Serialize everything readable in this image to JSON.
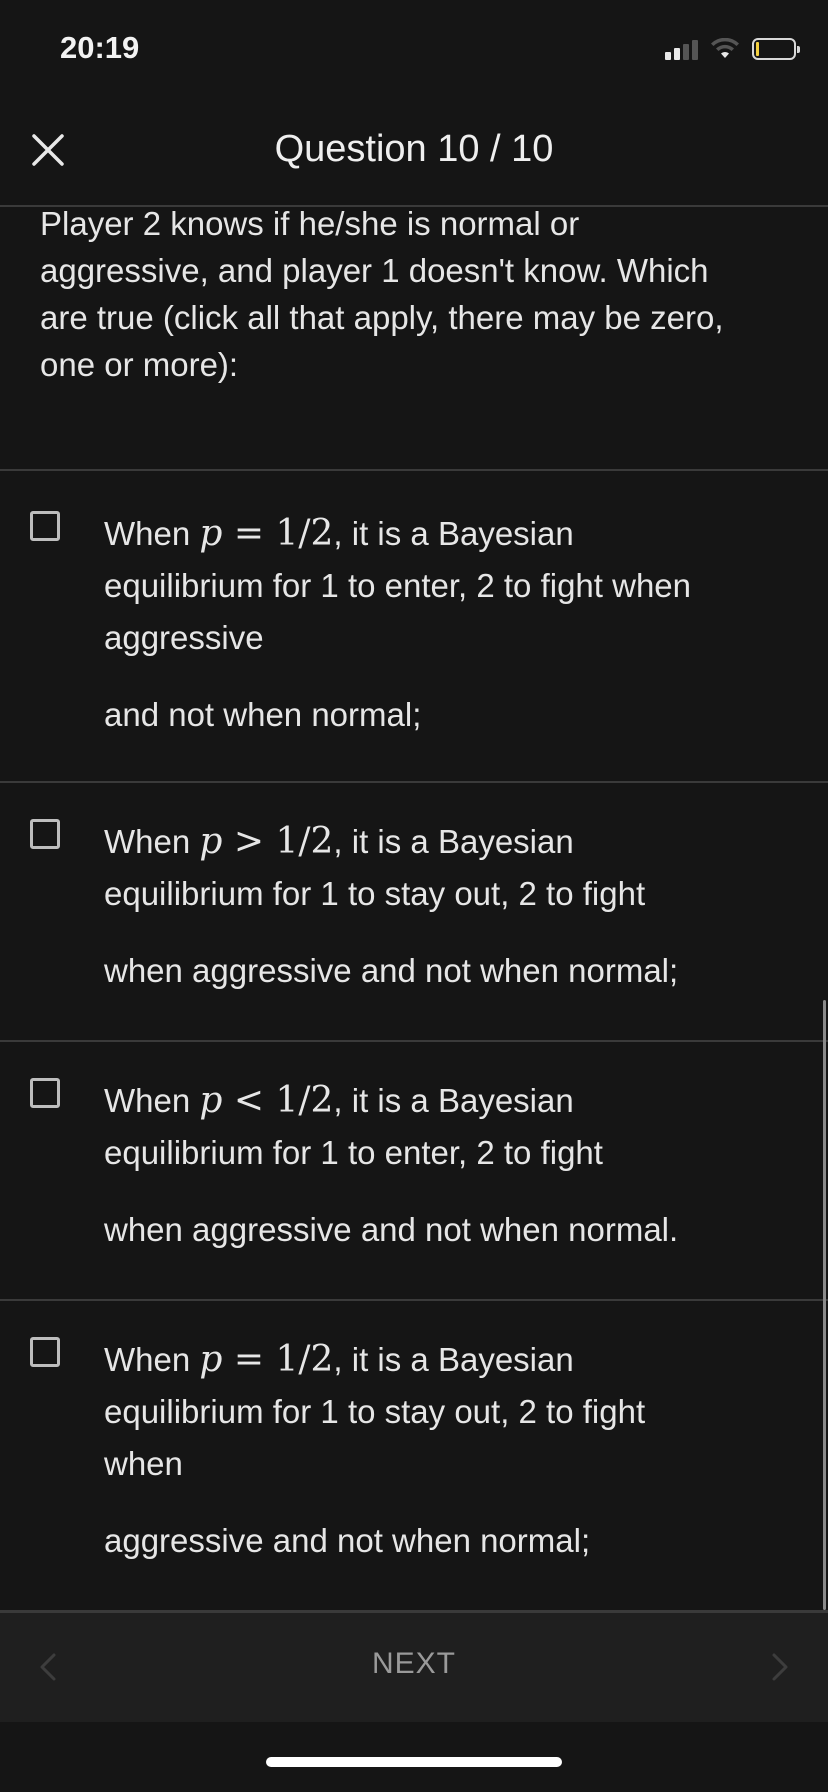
{
  "status_bar": {
    "time": "20:19",
    "icons": [
      "signal-icon",
      "wifi-icon",
      "battery-icon"
    ]
  },
  "header": {
    "title": "Question 10 / 10",
    "close_icon": "close-icon"
  },
  "question": {
    "lines": [
      "Player 2 knows if he/she is normal or",
      "aggressive, and player 1 doesn't know. Which",
      "are true (click all that apply, there may be zero,",
      "one or more):"
    ]
  },
  "options": [
    {
      "checked": false,
      "prefix": "When ",
      "math_var": "p",
      "math_op": " = ",
      "math_val": "1/2",
      "line1_rest": ", it is a Bayesian",
      "line2": "equilibrium for 1 to enter, 2 to fight when",
      "line3": "aggressive",
      "line4": "and not when normal;"
    },
    {
      "checked": false,
      "prefix": "When ",
      "math_var": "p",
      "math_op": " > ",
      "math_val": "1/2",
      "line1_rest": ", it is a Bayesian",
      "line2": "equilibrium for 1 to stay out, 2 to fight",
      "line3": "when aggressive and not when normal;"
    },
    {
      "checked": false,
      "prefix": "When ",
      "math_var": "p",
      "math_op": " < ",
      "math_val": "1/2",
      "line1_rest": ", it is a Bayesian",
      "line2": "equilibrium for 1 to enter, 2 to fight",
      "line3": "when aggressive and not when normal."
    },
    {
      "checked": false,
      "prefix": "When ",
      "math_var": "p",
      "math_op": " = ",
      "math_val": "1/2",
      "line1_rest": ", it is a Bayesian",
      "line2": "equilibrium for 1 to stay out, 2 to fight",
      "line3": "when",
      "line4": "aggressive and not when normal;"
    }
  ],
  "footer": {
    "next_label": "NEXT",
    "prev_icon": "chevron-left-icon",
    "next_icon": "chevron-right-icon"
  },
  "colors": {
    "background": "#151515",
    "footer_bg": "#1f1f1f",
    "text": "#e6e6e6",
    "divider": "#3a3a3a",
    "muted": "#9a9a9a"
  }
}
